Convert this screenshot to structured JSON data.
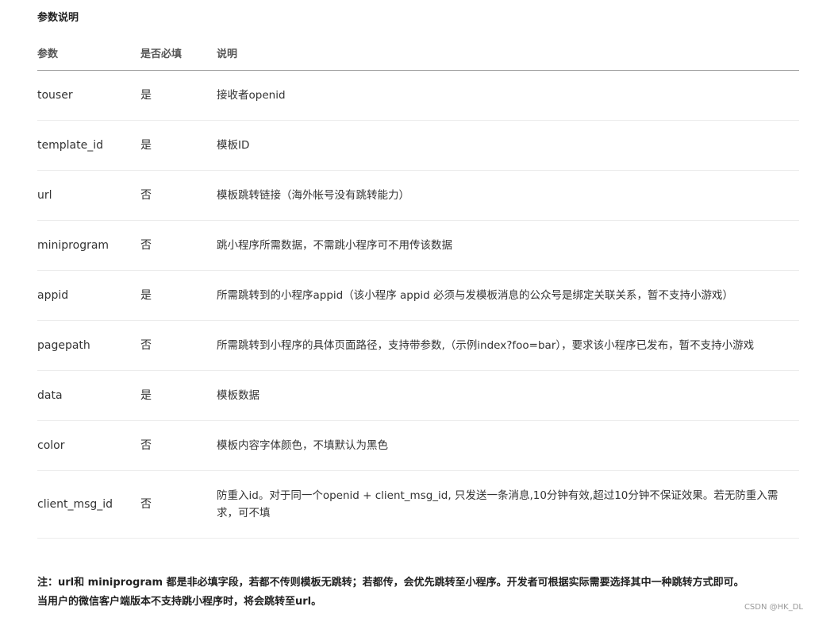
{
  "section_title": "参数说明",
  "table": {
    "headers": [
      "参数",
      "是否必填",
      "说明"
    ],
    "rows": [
      {
        "param": "touser",
        "required": "是",
        "desc": "接收者openid"
      },
      {
        "param": "template_id",
        "required": "是",
        "desc": "模板ID"
      },
      {
        "param": "url",
        "required": "否",
        "desc": "模板跳转链接（海外帐号没有跳转能力）"
      },
      {
        "param": "miniprogram",
        "required": "否",
        "desc": "跳小程序所需数据，不需跳小程序可不用传该数据"
      },
      {
        "param": "appid",
        "required": "是",
        "desc": "所需跳转到的小程序appid（该小程序 appid 必须与发模板消息的公众号是绑定关联关系，暂不支持小游戏）"
      },
      {
        "param": "pagepath",
        "required": "否",
        "desc": "所需跳转到小程序的具体页面路径，支持带参数,（示例index?foo=bar），要求该小程序已发布，暂不支持小游戏"
      },
      {
        "param": "data",
        "required": "是",
        "desc": "模板数据"
      },
      {
        "param": "color",
        "required": "否",
        "desc": "模板内容字体颜色，不填默认为黑色"
      },
      {
        "param": "client_msg_id",
        "required": "否",
        "desc": "防重入id。对于同一个openid + client_msg_id, 只发送一条消息,10分钟有效,超过10分钟不保证效果。若无防重入需求，可不填"
      }
    ]
  },
  "note": {
    "line1": "注：url和 miniprogram 都是非必填字段，若都不传则模板无跳转；若都传，会优先跳转至小程序。开发者可根据实际需要选择其中一种跳转方式即可。",
    "line2": "当用户的微信客户端版本不支持跳小程序时，将会跳转至url。"
  },
  "watermark": "CSDN @HK_DL"
}
